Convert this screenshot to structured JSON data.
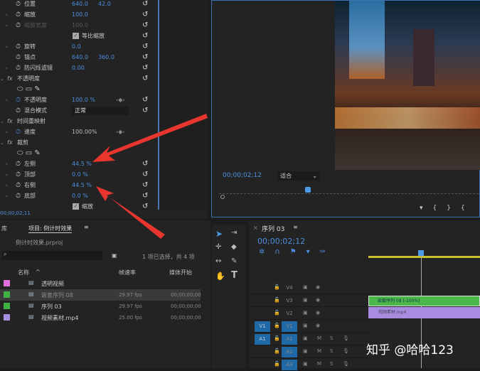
{
  "effects": {
    "rows": [
      {
        "label": "位置",
        "v1": "640.0",
        "v2": "42.0",
        "twirl": false,
        "reset": true
      },
      {
        "label": "缩放",
        "v1": "100.0",
        "twirl": true,
        "reset": true
      },
      {
        "label": "缩放宽度",
        "v1": "100.0",
        "twirl": true,
        "reset": true,
        "disabled": true
      },
      {
        "checkbox": "等比缩放",
        "reset": true
      },
      {
        "label": "旋转",
        "v1": "0.0",
        "twirl": true,
        "reset": true
      },
      {
        "label": "锚点",
        "v1": "640.0",
        "v2": "360.0",
        "reset": true
      },
      {
        "label": "防闪烁滤镜",
        "v1": "0.00",
        "twirl": true,
        "reset": true
      },
      {
        "section": "不透明度",
        "reset": true
      },
      {
        "masks": true
      },
      {
        "label": "不透明度",
        "v1": "100.0 %",
        "twirl": true,
        "reset": true,
        "kf": true
      },
      {
        "label": "混合模式",
        "select": "正常",
        "reset": true
      },
      {
        "section": "时间重映射"
      },
      {
        "label": "速度",
        "v1": "100.00%",
        "twirl": true,
        "kf": true,
        "plain": true
      },
      {
        "section": "裁剪"
      },
      {
        "masks": true
      },
      {
        "label": "左侧",
        "v1": "44.5 %",
        "twirl": true,
        "reset": true
      },
      {
        "label": "顶部",
        "v1": "0.0 %",
        "twirl": true,
        "reset": true
      },
      {
        "label": "右侧",
        "v1": "44.5 %",
        "twirl": true,
        "reset": true
      },
      {
        "label": "底部",
        "v1": "0.0 %",
        "twirl": true,
        "reset": true
      },
      {
        "checkbox": "缩放",
        "reset": true
      }
    ],
    "timecode": "00;00;02;11"
  },
  "monitor": {
    "timecode": "00;00;02;12",
    "fit": "适合"
  },
  "project": {
    "tab_prev": "库",
    "tab": "项目: 倒计时效果",
    "file": "倒计时效果.prproj",
    "selection": "1 项已选择，共 4 项",
    "columns": [
      "名称",
      "帧速率",
      "媒体开始"
    ],
    "items": [
      {
        "color": "#e070e0",
        "name": "透明视频",
        "fps": "",
        "start": ""
      },
      {
        "color": "#40b040",
        "name": "嵌套序列 08",
        "fps": "29.97 fps",
        "start": "00;00;00;00",
        "selected": true
      },
      {
        "color": "#40b040",
        "name": "序列 03",
        "fps": "29.97 fps",
        "start": "00;00;00;00"
      },
      {
        "color": "#a890e0",
        "name": "视频素材.mp4",
        "fps": "25.00 fps",
        "start": "00;00;00;00"
      }
    ]
  },
  "timeline": {
    "title": "序列 03",
    "timecode": "00;00;02;12",
    "tracks": [
      "V4",
      "V3",
      "V2",
      "V1",
      "A1",
      "A2",
      "A3"
    ],
    "source_v": "V1",
    "source_a": "A1",
    "mute": "M",
    "solo": "S",
    "clips": [
      {
        "name": "嵌套序列 08 [-100%]",
        "color": "#4cb84c"
      },
      {
        "name": "视频素材.mp4",
        "color": "#a88ce0"
      }
    ]
  },
  "watermark": "知乎 @哈哈123"
}
